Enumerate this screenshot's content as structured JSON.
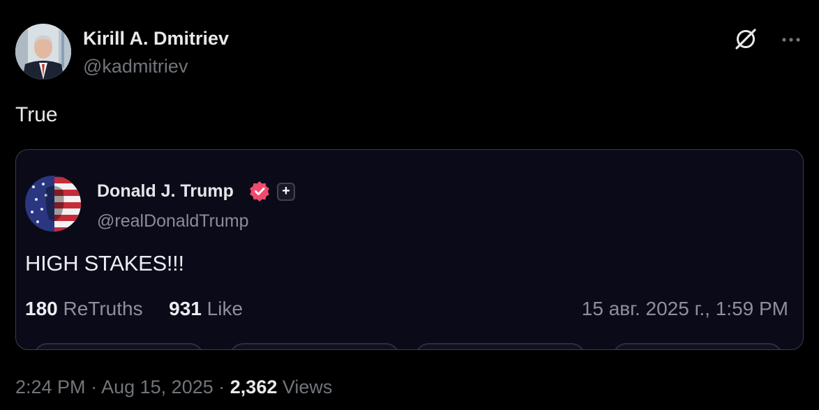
{
  "tweet": {
    "author_name": "Kirill A. Dmitriev",
    "author_handle": "@kadmitriev",
    "text": "True",
    "time": "2:24 PM",
    "separator": "·",
    "date": "Aug 15, 2025",
    "views_count": "2,362",
    "views_label": "Views",
    "icons": {
      "grok": "grok-icon",
      "more": "more-icon"
    }
  },
  "quote": {
    "author_name": "Donald J. Trump",
    "author_handle": "@realDonaldTrump",
    "text": "HIGH STAKES!!!",
    "retruths_count": "180",
    "retruths_label": "ReTruths",
    "likes_count": "931",
    "likes_label": "Like",
    "timestamp": "15 авг. 2025 г., 1:59 PM",
    "follow_symbol": "+",
    "verified_color": "#f24a6e"
  }
}
